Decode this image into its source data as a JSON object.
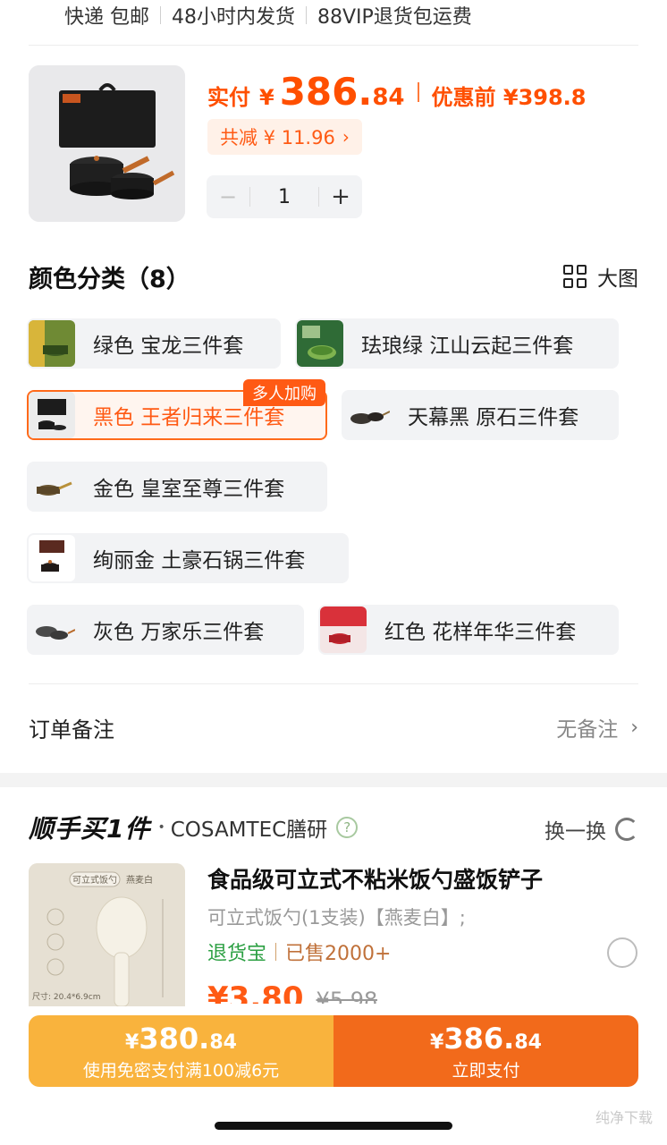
{
  "shipping": {
    "items": [
      "快递 包邮",
      "48小时内发货",
      "88VIP退货包运费"
    ]
  },
  "product": {
    "price_label": "实付",
    "currency": "¥",
    "price_int": "386.",
    "price_dec": "84",
    "before_price": "优惠前 ¥398.8",
    "reduce": "共减 ¥ 11.96",
    "reduce_chev": "›",
    "qty": "1",
    "minus": "−",
    "plus": "+"
  },
  "colors": {
    "title": "颜色分类（8）",
    "big_view": "大图",
    "options": [
      {
        "label": "绿色 宝龙三件套",
        "thumb_color": "#5c7a2e"
      },
      {
        "label": "珐琅绿 江山云起三件套",
        "thumb_color": "#3f6b3a"
      },
      {
        "label": "黑色 王者归来三件套",
        "thumb_color": "#2a2a2a",
        "selected": true,
        "tag": "多人加购"
      },
      {
        "label": "天幕黑 原石三件套",
        "thumb_color": "#3a3530"
      },
      {
        "label": "金色 皇室至尊三件套",
        "thumb_color": "#8a6a3a"
      },
      {
        "label": "绚丽金 土豪石锅三件套",
        "thumb_color": "#4a3428"
      },
      {
        "label": "灰色 万家乐三件套",
        "thumb_color": "#4a4a4a"
      },
      {
        "label": "红色 花样年华三件套",
        "thumb_color": "#d9313a"
      }
    ]
  },
  "note": {
    "label": "订单备注",
    "value": "无备注",
    "chev": "›"
  },
  "addon": {
    "brand": "顺手买1件",
    "dot": "•",
    "shop": "COSAMTEC膳研",
    "help": "?",
    "swap": "换一换",
    "title": "食品级可立式不粘米饭勺盛饭铲子",
    "sku": "可立式饭勺(1支装)【燕麦白】;",
    "tag_return": "退货宝",
    "tag_sold": "已售2000+",
    "price": "¥3.80",
    "orig_price": "¥5.98",
    "img_label_1": "可立式饭勺",
    "img_label_2": "燕麦白",
    "img_dim": "尺寸: 20.4*6.9cm"
  },
  "pay": {
    "left_currency": "¥",
    "left_int": "380.",
    "left_dec": "84",
    "left_sub": "使用免密支付满100减6元",
    "right_currency": "¥",
    "right_int": "386.",
    "right_dec": "84",
    "right_sub": "立即支付"
  },
  "watermark": "纯净下载"
}
